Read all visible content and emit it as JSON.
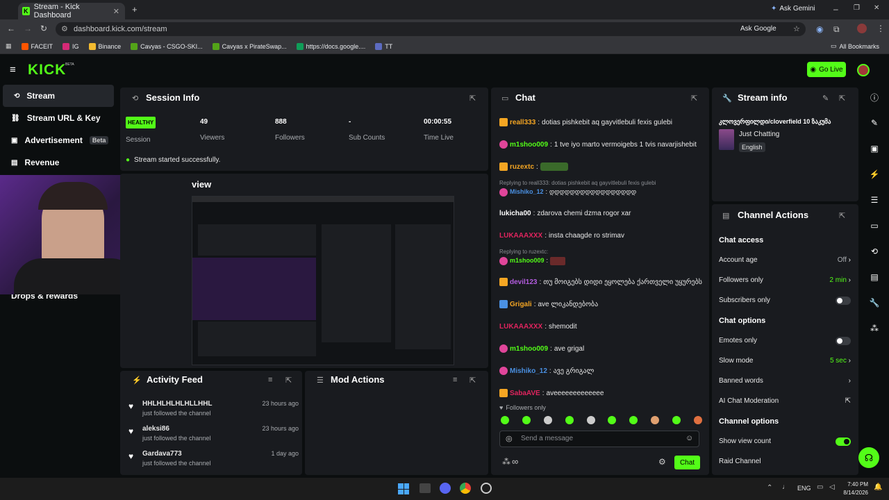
{
  "browser": {
    "tab_title": "Stream - Kick Dashboard",
    "url": "dashboard.kick.com/stream",
    "ask_google": "Ask Google",
    "ask_gemini": "Ask Gemini",
    "bookmarks": [
      "FACEIT",
      "IG",
      "Binance",
      "Cavyas - CSGO-SKI...",
      "Cavyas x PirateSwap...",
      "https://docs.google....",
      "TT"
    ],
    "all_bookmarks": "All Bookmarks"
  },
  "header": {
    "logo": "KICK",
    "logo_sup": "BETA",
    "go_live": "Go Live"
  },
  "nav": {
    "items": [
      {
        "label": "Stream"
      },
      {
        "label": "Stream URL & Key"
      },
      {
        "label": "Advertisement",
        "badge": "Beta"
      },
      {
        "label": "Revenue"
      },
      {
        "label": "Drops & rewards"
      }
    ]
  },
  "session": {
    "title": "Session Info",
    "health": "HEALTHY",
    "session_label": "Session",
    "stats": [
      {
        "value": "49",
        "label": "Viewers"
      },
      {
        "value": "888",
        "label": "Followers"
      },
      {
        "value": "-",
        "label": "Sub Counts"
      },
      {
        "value": "00:00:55",
        "label": "Time Live"
      }
    ],
    "success": "Stream started successfully.",
    "preview_label": "view"
  },
  "activity": {
    "title": "Activity Feed",
    "items": [
      {
        "name": "HHLHLHLHLHLLHHL",
        "action": "just followed the channel",
        "time": "23 hours ago"
      },
      {
        "name": "aleksi86",
        "action": "just followed the channel",
        "time": "23 hours ago"
      },
      {
        "name": "Gardava773",
        "action": "just followed the channel",
        "time": "1 day ago"
      }
    ]
  },
  "mod_actions": {
    "title": "Mod Actions"
  },
  "chat": {
    "title": "Chat",
    "messages": [
      {
        "badge": "13",
        "user": "reall333",
        "color": "#f5a623",
        "text": "dotias pishkebit aq gayvitlebuli fexis gulebi"
      },
      {
        "badge": "",
        "user": "m1shoo009",
        "color": "#53fc18",
        "text": "1 tve iyo marto vermoigebs 1 tvis navarjishebit"
      },
      {
        "badge": "16",
        "user": "ruzextc",
        "color": "#f5a623",
        "text": ""
      },
      {
        "badge": "",
        "user": "Mishiko_12",
        "color": "#4a90e2",
        "text": "დდდდდდდდდდდდდდდდდ",
        "reply": "Replying to reall333: dotias pishkebit aq gayvitlebuli fexis gulebi"
      },
      {
        "badge": "",
        "user": "lukicha00",
        "color": "#ffffff",
        "text": "zdarova chemi dzma rogor xar"
      },
      {
        "badge": "",
        "user": "LUKAAAXXX",
        "color": "#e0245e",
        "text": "insta chaagde ro strimav"
      },
      {
        "badge": "",
        "user": "m1shoo009",
        "color": "#53fc18",
        "text": "",
        "reply": "Replying to ruzextc:"
      },
      {
        "badge": "13",
        "user": "devil123",
        "color": "#b45ce0",
        "text": "თუ მოიგებს დიდი ეყოლება ქართველი უყურებს"
      },
      {
        "badge": "",
        "user": "Grigali",
        "color": "#f5a623",
        "text": "ave ლიკანდებობა"
      },
      {
        "badge": "",
        "user": "LUKAAAXXX",
        "color": "#e0245e",
        "text": "shemodit"
      },
      {
        "badge": "",
        "user": "m1shoo009",
        "color": "#53fc18",
        "text": "ave grigal"
      },
      {
        "badge": "",
        "user": "Mishiko_12",
        "color": "#4a90e2",
        "text": "ავე გრიგალ"
      },
      {
        "badge": "13",
        "user": "SabaAVE",
        "color": "#e0245e",
        "text": "aveeeeeeeeeeeee"
      }
    ],
    "followers_only": "Followers only",
    "placeholder": "Send a message",
    "send": "Chat",
    "infinity": "∞"
  },
  "stream_info": {
    "title": "Stream info",
    "stream_title": "კლოვერფილდი/cloverfield 10 ზაკუმა",
    "category": "Just Chatting",
    "language": "English"
  },
  "channel_actions": {
    "title": "Channel Actions",
    "chat_access": "Chat access",
    "account_age": {
      "label": "Account age",
      "value": "Off"
    },
    "followers_only": {
      "label": "Followers only",
      "value": "2 min"
    },
    "subscribers_only": {
      "label": "Subscribers only",
      "on": false
    },
    "chat_options": "Chat options",
    "emotes_only": {
      "label": "Emotes only",
      "on": false
    },
    "slow_mode": {
      "label": "Slow mode",
      "value": "5 sec"
    },
    "banned_words": {
      "label": "Banned words"
    },
    "ai_moderation": {
      "label": "AI Chat Moderation"
    },
    "channel_options": "Channel options",
    "show_view_count": {
      "label": "Show view count",
      "on": true
    },
    "raid_channel": {
      "label": "Raid Channel"
    }
  },
  "taskbar": {
    "lang": "ENG",
    "time": "7:40 PM",
    "date": "8/14/2026"
  },
  "colors": {
    "accent": "#53fc18",
    "panel": "#191b1f",
    "bg": "#0b0e0f"
  }
}
